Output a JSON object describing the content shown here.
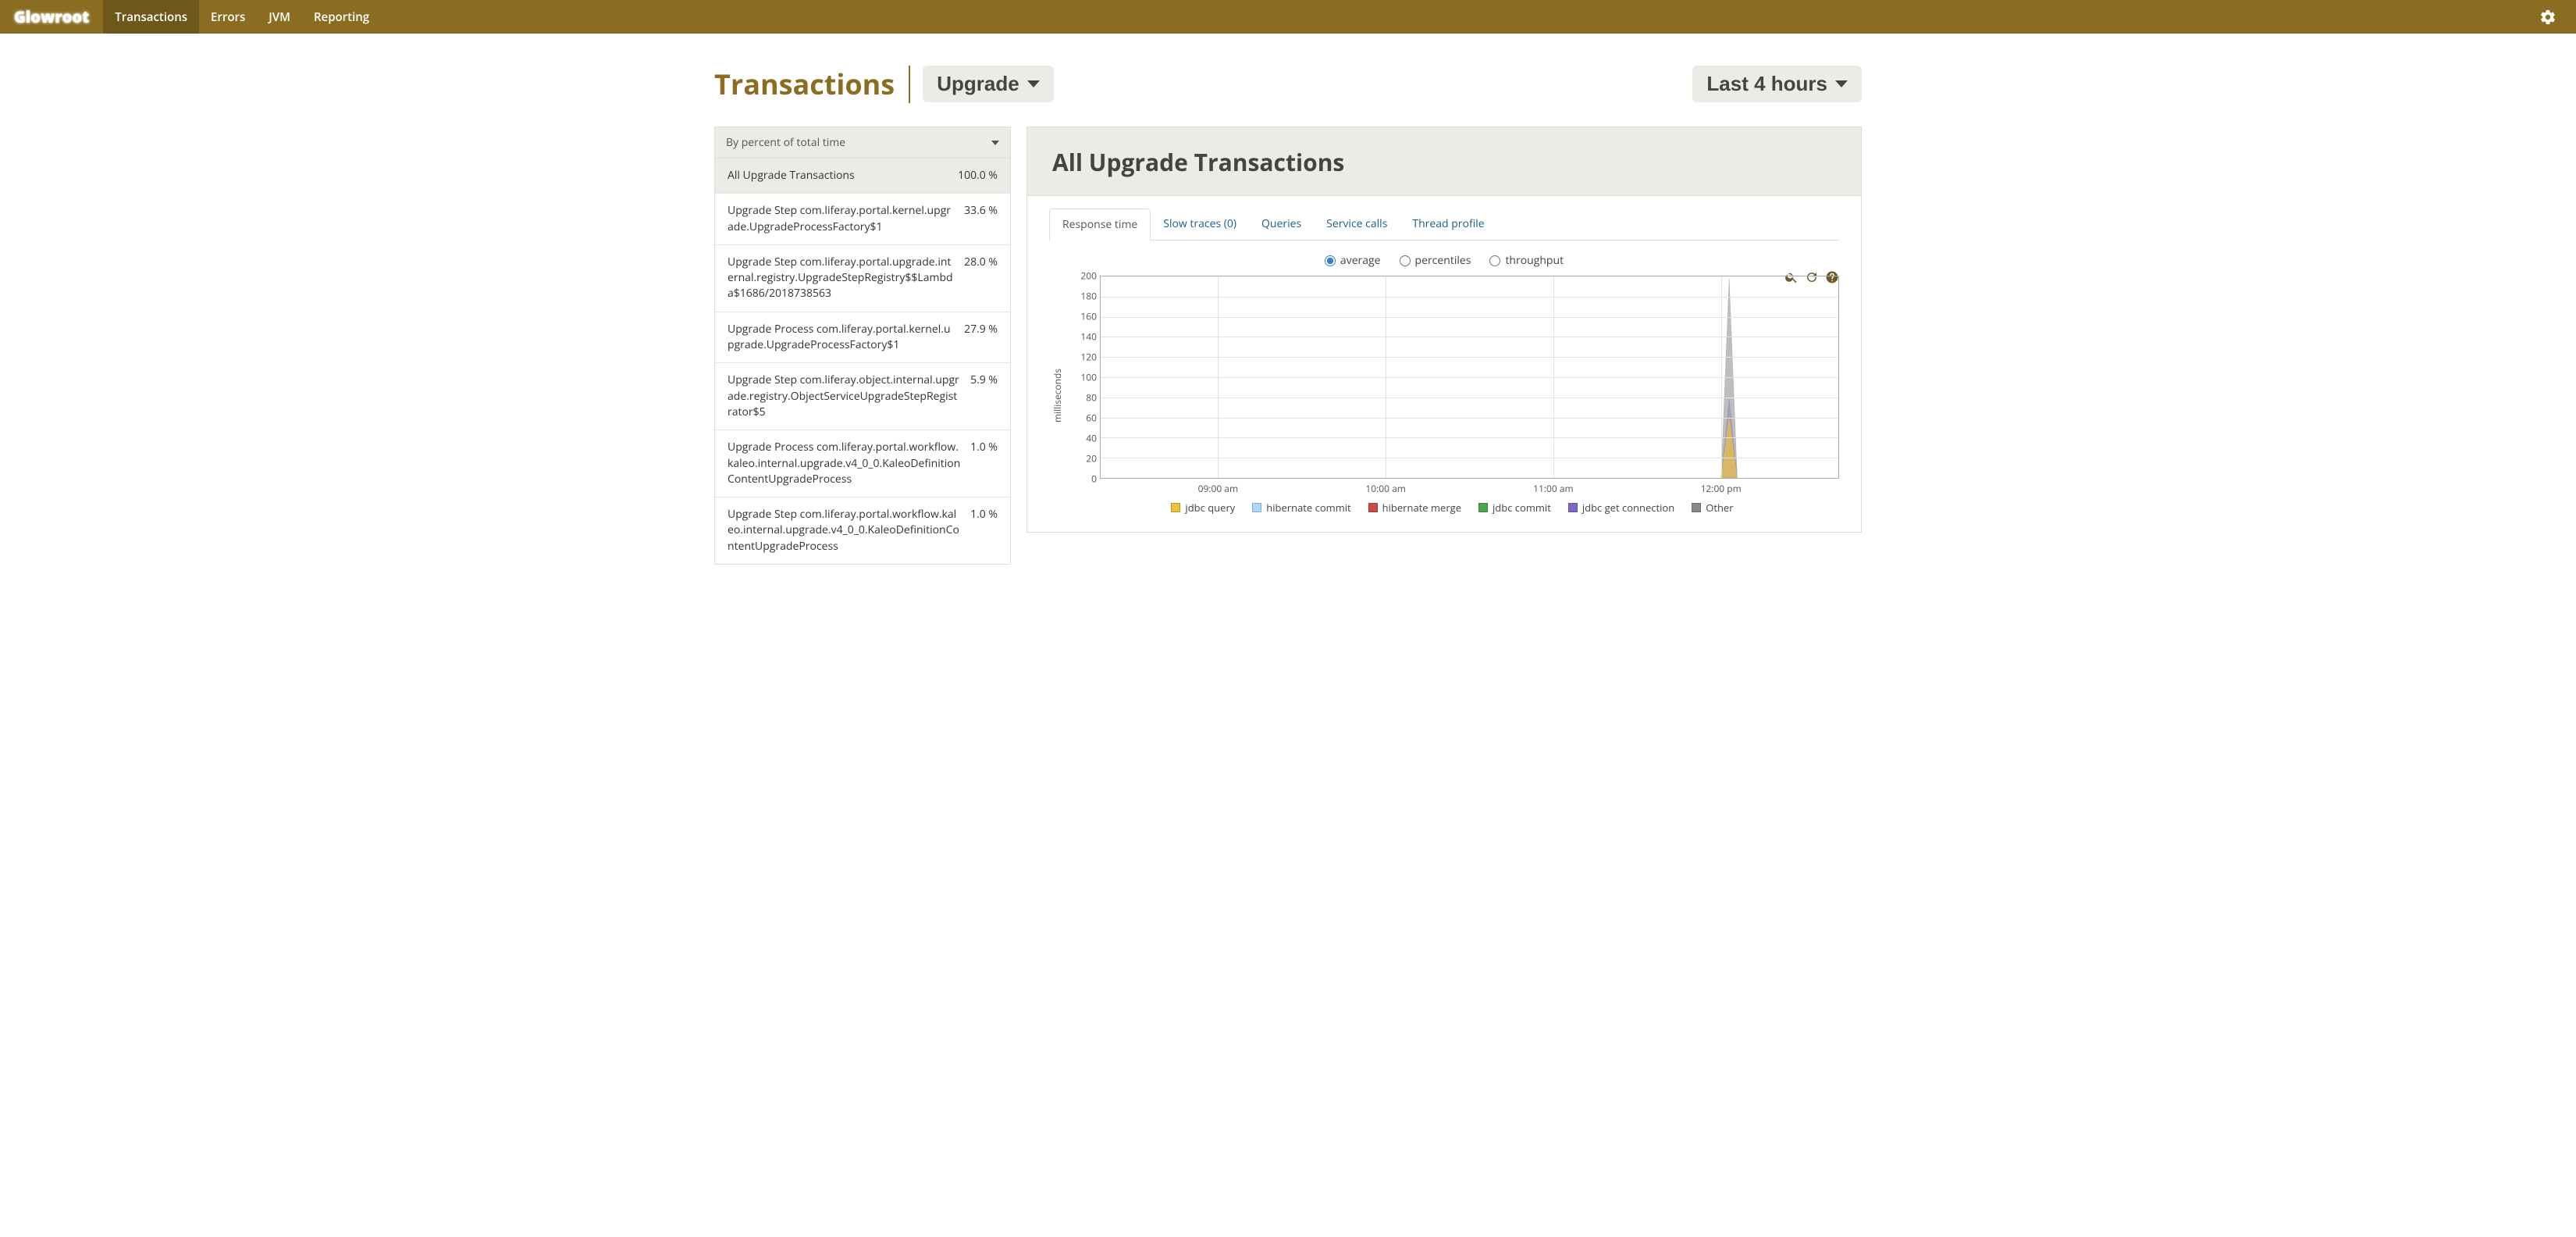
{
  "brand": "Glowroot",
  "nav": {
    "items": [
      {
        "label": "Transactions",
        "active": true
      },
      {
        "label": "Errors",
        "active": false
      },
      {
        "label": "JVM",
        "active": false
      },
      {
        "label": "Reporting",
        "active": false
      }
    ]
  },
  "header": {
    "title": "Transactions",
    "type_dropdown": "Upgrade",
    "time_dropdown": "Last 4 hours"
  },
  "sidebar": {
    "sort_label": "By percent of total time",
    "items": [
      {
        "name": "All Upgrade Transactions",
        "pct": "100.0 %",
        "selected": true
      },
      {
        "name": "Upgrade Step com.liferay.portal.kernel.upgrade.UpgradeProcessFactory$1",
        "pct": "33.6 %"
      },
      {
        "name": "Upgrade Step com.liferay.portal.upgrade.internal.registry.UpgradeStepRegistry$$Lambda$1686/2018738563",
        "pct": "28.0 %"
      },
      {
        "name": "Upgrade Process com.liferay.portal.kernel.upgrade.UpgradeProcessFactory$1",
        "pct": "27.9 %"
      },
      {
        "name": "Upgrade Step com.liferay.object.internal.upgrade.registry.ObjectServiceUpgradeStepRegistrator$5",
        "pct": "5.9 %"
      },
      {
        "name": "Upgrade Process com.liferay.portal.workflow.kaleo.internal.upgrade.v4_0_0.KaleoDefinitionContentUpgradeProcess",
        "pct": "1.0 %"
      },
      {
        "name": "Upgrade Step com.liferay.portal.workflow.kaleo.internal.upgrade.v4_0_0.KaleoDefinitionContentUpgradeProcess",
        "pct": "1.0 %"
      }
    ]
  },
  "panel": {
    "title": "All Upgrade Transactions",
    "tabs": [
      {
        "label": "Response time",
        "active": true
      },
      {
        "label": "Slow traces (0)"
      },
      {
        "label": "Queries"
      },
      {
        "label": "Service calls"
      },
      {
        "label": "Thread profile"
      }
    ],
    "radios": [
      {
        "label": "average",
        "checked": true
      },
      {
        "label": "percentiles",
        "checked": false
      },
      {
        "label": "throughput",
        "checked": false
      }
    ]
  },
  "chart_data": {
    "type": "area",
    "ylabel": "milliseconds",
    "ylim": [
      0,
      200
    ],
    "y_ticks": [
      0,
      20,
      40,
      60,
      80,
      100,
      120,
      140,
      160,
      180,
      200
    ],
    "x_ticks": [
      "09:00 am",
      "10:00 am",
      "11:00 am",
      "12:00 pm"
    ],
    "x_range_hours": 4,
    "series": [
      {
        "name": "jdbc query",
        "color": "#edc240",
        "peak_value": 62,
        "peak_x_hour": 3.99
      },
      {
        "name": "hibernate commit",
        "color": "#afd8f8",
        "peak_value": 0,
        "peak_x_hour": 3.99
      },
      {
        "name": "hibernate merge",
        "color": "#cb4b4b",
        "peak_value": 0,
        "peak_x_hour": 3.99
      },
      {
        "name": "jdbc commit",
        "color": "#4da74d",
        "peak_value": 0,
        "peak_x_hour": 3.99
      },
      {
        "name": "jdbc get connection",
        "color": "#7f66c5",
        "peak_value": 78,
        "peak_x_hour": 3.99
      },
      {
        "name": "Other",
        "color": "#888888",
        "peak_value": 198,
        "peak_x_hour": 3.99
      }
    ],
    "spike": {
      "x_center_pct": 85.2,
      "half_width_pct": 1.1,
      "other_top_pct": 1.0,
      "purple_top_pct": 61.0,
      "yellow_top_pct": 69.0
    }
  }
}
